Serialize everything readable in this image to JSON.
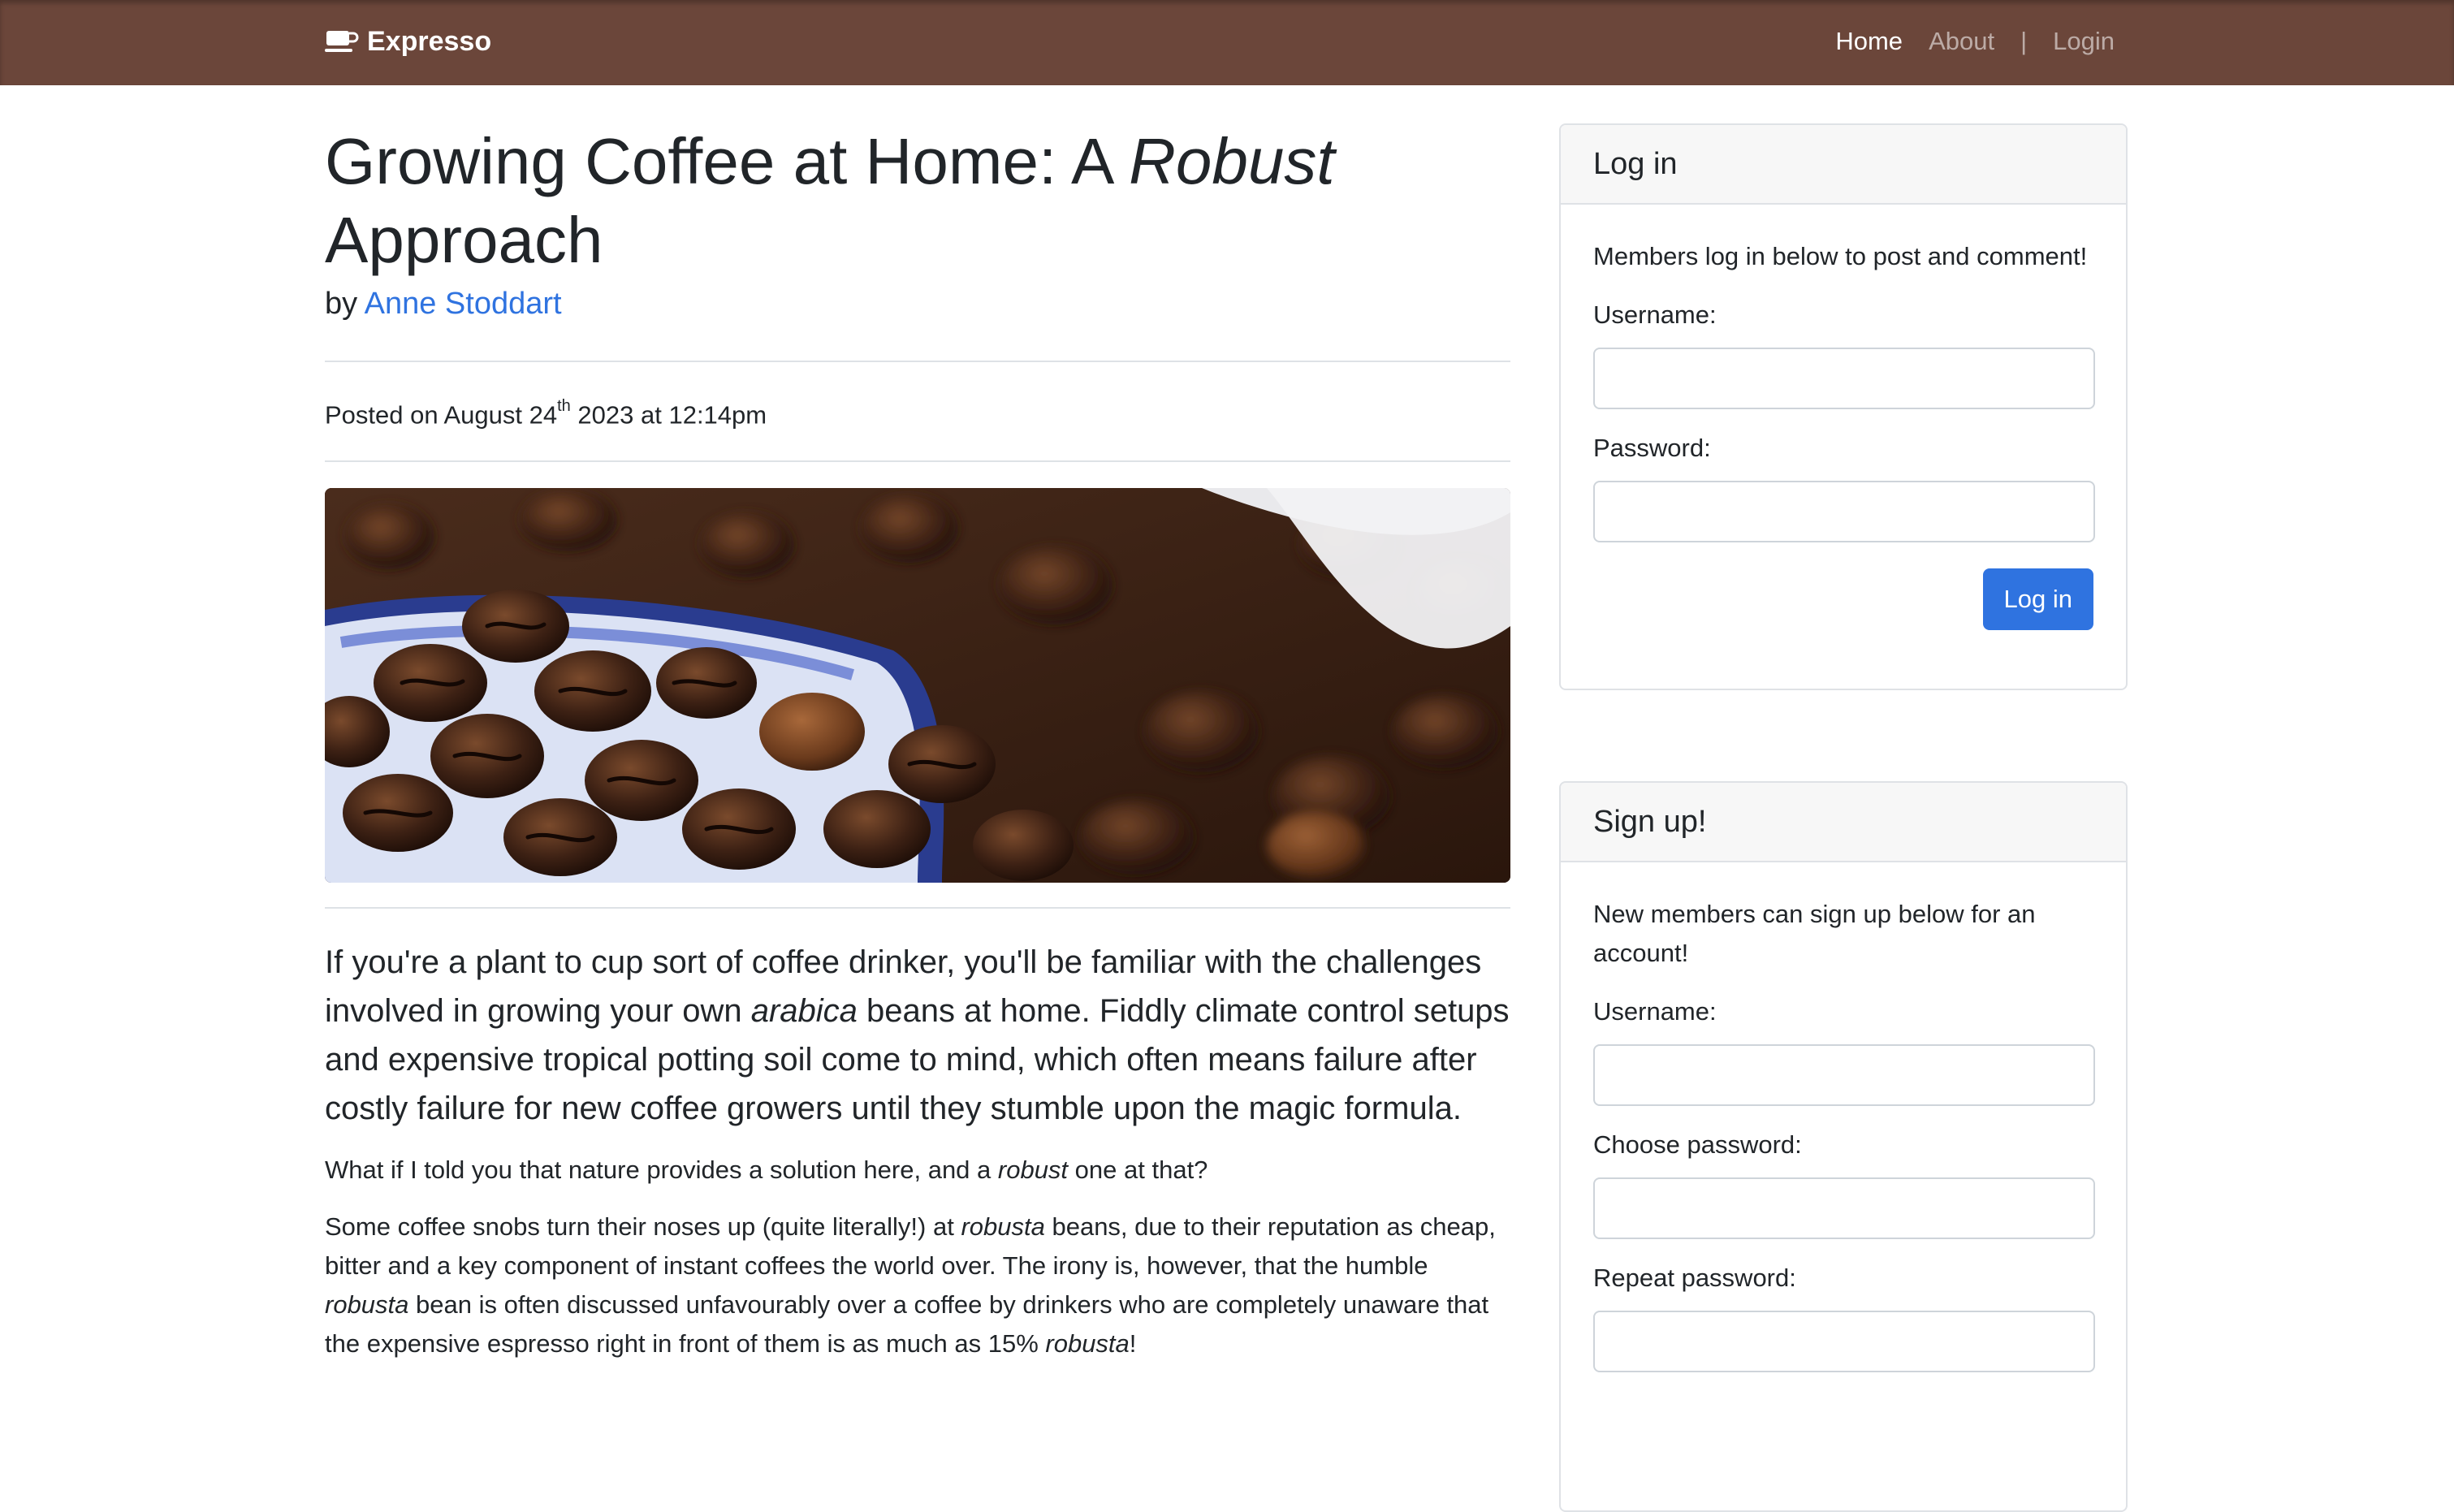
{
  "nav": {
    "brand": "Expresso",
    "links": [
      {
        "label": "Home"
      },
      {
        "label": "About"
      },
      {
        "label": "|"
      },
      {
        "label": "Login"
      }
    ]
  },
  "article": {
    "title_part1": "Growing Coffee at Home: A ",
    "title_italic": "Robust",
    "title_part2": " Approach",
    "by": "by ",
    "author": "Anne Stoddart",
    "posted_prefix": "Posted on August 24",
    "posted_sup": "th",
    "posted_suffix": " 2023 at 12:14pm",
    "lead": {
      "t1": "If you're a plant to cup sort of coffee drinker, you'll be familiar with the challenges involved in growing your own ",
      "i1": "arabica",
      "t2": " beans at home. Fiddly climate control setups and expensive tropical potting soil come to mind, which often means failure after costly failure for new coffee growers until they stumble upon the magic formula."
    },
    "p1": {
      "t1": "What if I told you that nature provides a solution here, and a ",
      "i1": "robust",
      "t2": " one at that?"
    },
    "p2": {
      "t1": "Some coffee snobs turn their noses up (quite literally!) at ",
      "i1": "robusta",
      "t2": " beans, due to their reputation as cheap, bitter and a key component of instant coffees the world over. The irony is, however, that the humble ",
      "i2": "robusta",
      "t3": " bean is often discussed unfavourably over a coffee by drinkers who are completely unaware that the expensive espresso right in front of them is as much as 15% ",
      "i3": "robusta",
      "t4": "!"
    }
  },
  "login": {
    "header": "Log in",
    "text": "Members log in below to post and comment!",
    "username_label": "Username:",
    "password_label": "Password:",
    "button": "Log in"
  },
  "signup": {
    "header": "Sign up!",
    "text": "New members can sign up below for an account!",
    "username_label": "Username:",
    "password_label": "Choose password:",
    "repeat_label": "Repeat password:"
  },
  "colors": {
    "navbar": "#6b463a",
    "link": "#2f73e0",
    "button": "#2f73e0"
  }
}
